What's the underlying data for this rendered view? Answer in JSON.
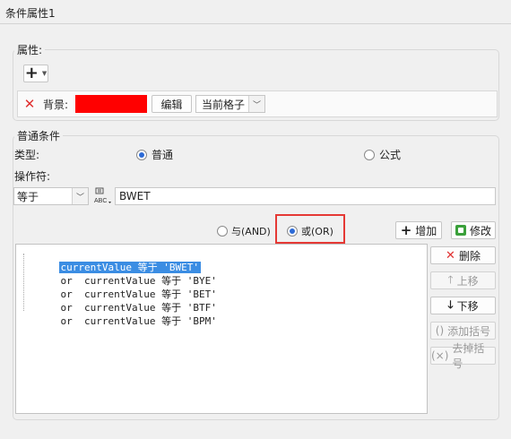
{
  "window": {
    "title": "条件属性1"
  },
  "attributes": {
    "group_label": "属性:",
    "add_icon": "plus-icon",
    "row": {
      "delete_icon": "close-icon",
      "label": "背景:",
      "color": "#ff0000",
      "edit_label": "编辑",
      "scope_value": "当前格子"
    }
  },
  "conditions": {
    "group_label": "普通条件",
    "type_label": "类型:",
    "type_options": [
      {
        "label": "普通",
        "selected": true
      },
      {
        "label": "公式",
        "selected": false
      }
    ],
    "operator_label": "操作符:",
    "operator_value": "等于",
    "value_type_icon": "abc-icon",
    "value_text": "BWET",
    "logic_options": [
      {
        "label": "与(AND)",
        "selected": false
      },
      {
        "label": "或(OR)",
        "selected": true
      }
    ],
    "add_label": "增加",
    "modify_label": "修改",
    "list_items": [
      "currentValue 等于 'BWET'",
      "or  currentValue 等于 'BYE'",
      "or  currentValue 等于 'BET'",
      "or  currentValue 等于 'BTF'",
      "or  currentValue 等于 'BPM'"
    ],
    "side_buttons": {
      "delete": "删除",
      "move_up": "上移",
      "move_down": "下移",
      "add_bracket": "添加括号",
      "remove_bracket": "去掉括号"
    }
  },
  "colors": {
    "highlight_box": "#e53935",
    "selection": "#3b8de3"
  }
}
